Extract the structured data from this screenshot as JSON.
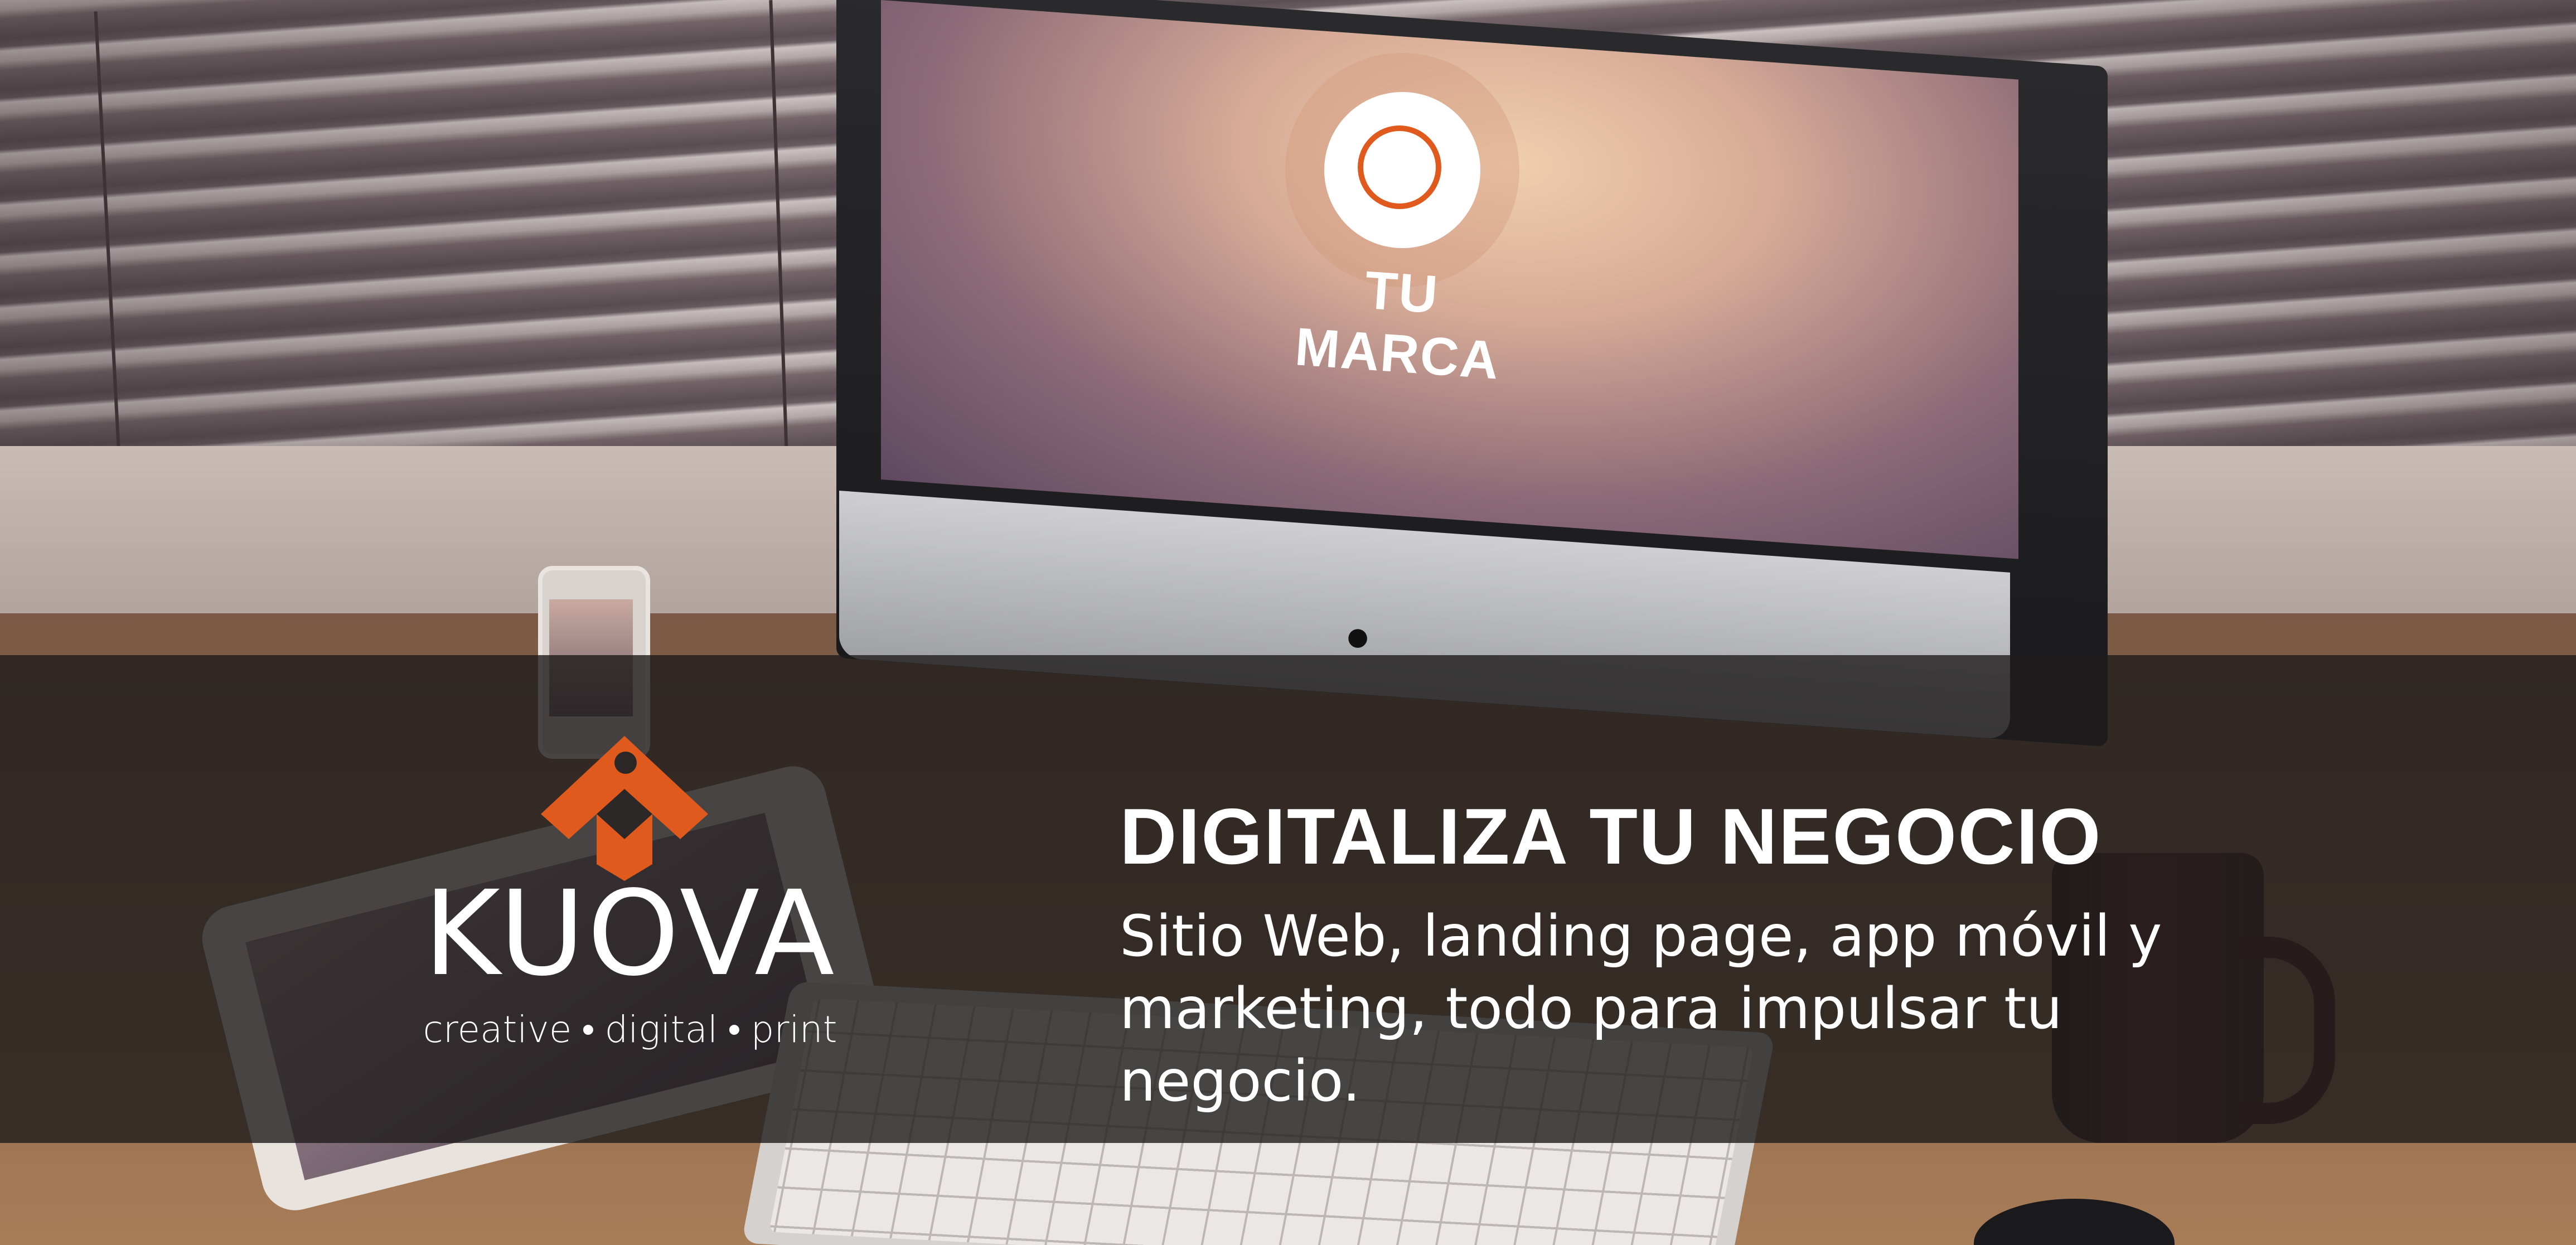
{
  "screen": {
    "brand_label": "TU MARCA"
  },
  "logo": {
    "name": "KUOVA",
    "tagline": [
      "creative",
      "digital",
      "print"
    ],
    "tagline_separator": "•",
    "accent_color": "#e05a1e"
  },
  "banner": {
    "headline": "DIGITALIZA TU NEGOCIO",
    "body_line1": "Sitio Web, landing page, app móvil y",
    "body_line2": "marketing, todo para impulsar tu negocio.",
    "overlay_color": "#1e1c1c"
  }
}
